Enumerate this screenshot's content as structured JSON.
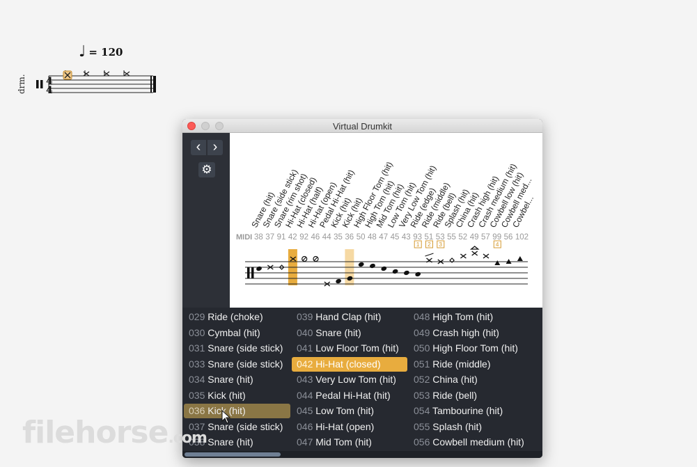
{
  "score": {
    "tempo_mark": "= 120",
    "staff_label": "drm.",
    "time_signature": [
      "4",
      "4"
    ]
  },
  "window": {
    "title": "Virtual Drumkit",
    "prev_label": "‹",
    "next_label": "›",
    "settings_icon": "gear-icon"
  },
  "drumkit": {
    "midi_label": "MIDI",
    "columns": [
      {
        "name": "Snare (hit)",
        "midi": "38"
      },
      {
        "name": "Snare (side stick)",
        "midi": "37"
      },
      {
        "name": "Snare (rim shot)",
        "midi": "91"
      },
      {
        "name": "Hi-Hat (closed)",
        "midi": "42"
      },
      {
        "name": "Hi-Hat (half)",
        "midi": "92"
      },
      {
        "name": "Hi-Hat (open)",
        "midi": "46"
      },
      {
        "name": "Pedal Hi-Hat (hit)",
        "midi": "44"
      },
      {
        "name": "Kick (hit)",
        "midi": "35"
      },
      {
        "name": "Kick (hit)",
        "midi": "36"
      },
      {
        "name": "High Floor Tom (hit)",
        "midi": "50"
      },
      {
        "name": "High Tom (hit)",
        "midi": "48"
      },
      {
        "name": "Mid Tom (hit)",
        "midi": "47"
      },
      {
        "name": "Low Tom (hit)",
        "midi": "45"
      },
      {
        "name": "Very Low Tom (hit)",
        "midi": "43"
      },
      {
        "name": "Ride (edge)",
        "midi": "93"
      },
      {
        "name": "Ride (middle)",
        "midi": "51"
      },
      {
        "name": "Ride (bell)",
        "midi": "53"
      },
      {
        "name": "Splash (hit)",
        "midi": "55"
      },
      {
        "name": "China (hit)",
        "midi": "52"
      },
      {
        "name": "Crash high (hit)",
        "midi": "49"
      },
      {
        "name": "Crash medium (hit)",
        "midi": "57"
      },
      {
        "name": "Cowbell low (hit)",
        "midi": "99"
      },
      {
        "name": "Cowbell med...",
        "midi": "56"
      },
      {
        "name": "Cowbel...",
        "midi": "102"
      }
    ],
    "badges": [
      "1",
      "2",
      "3",
      "4"
    ],
    "highlight_color": "#e8ac3e"
  },
  "instruments": {
    "columns": [
      [
        {
          "num": "029",
          "name": "Ride (choke)"
        },
        {
          "num": "030",
          "name": "Cymbal (hit)"
        },
        {
          "num": "031",
          "name": "Snare (side stick)"
        },
        {
          "num": "033",
          "name": "Snare (side stick)"
        },
        {
          "num": "034",
          "name": "Snare (hit)"
        },
        {
          "num": "035",
          "name": "Kick (hit)"
        },
        {
          "num": "036",
          "name": "Kick (hit)"
        },
        {
          "num": "037",
          "name": "Snare (side stick)"
        },
        {
          "num": "038",
          "name": "Snare (hit)"
        }
      ],
      [
        {
          "num": "039",
          "name": "Hand Clap (hit)"
        },
        {
          "num": "040",
          "name": "Snare (hit)"
        },
        {
          "num": "041",
          "name": "Low Floor Tom (hit)"
        },
        {
          "num": "042",
          "name": "Hi-Hat (closed)"
        },
        {
          "num": "043",
          "name": "Very Low Tom (hit)"
        },
        {
          "num": "044",
          "name": "Pedal Hi-Hat (hit)"
        },
        {
          "num": "045",
          "name": "Low Tom (hit)"
        },
        {
          "num": "046",
          "name": "Hi-Hat (open)"
        },
        {
          "num": "047",
          "name": "Mid Tom (hit)"
        }
      ],
      [
        {
          "num": "048",
          "name": "High Tom (hit)"
        },
        {
          "num": "049",
          "name": "Crash high (hit)"
        },
        {
          "num": "050",
          "name": "High Floor Tom (hit)"
        },
        {
          "num": "051",
          "name": "Ride (middle)"
        },
        {
          "num": "052",
          "name": "China (hit)"
        },
        {
          "num": "053",
          "name": "Ride (bell)"
        },
        {
          "num": "054",
          "name": "Tambourine (hit)"
        },
        {
          "num": "055",
          "name": "Splash (hit)"
        },
        {
          "num": "056",
          "name": "Cowbell medium (hit)"
        }
      ]
    ],
    "selected": "042",
    "hovered": "036"
  },
  "watermark": {
    "brand": "filehorse",
    "suffix": ".com"
  }
}
